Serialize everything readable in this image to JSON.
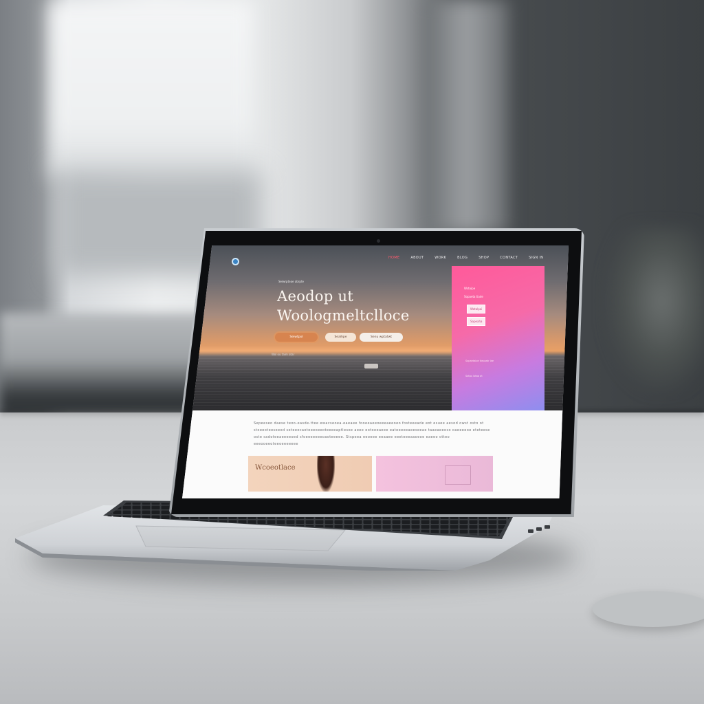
{
  "scene": {
    "description_colors": {
      "room_light": "#eceeef",
      "room_dark": "#3b3f42",
      "table": "#d4d6d8",
      "laptop_aluminium": "#c8ccd0",
      "bezel": "#111214"
    }
  },
  "website": {
    "logo": "brand-logo-icon",
    "nav": [
      {
        "label": "HOME",
        "active": true
      },
      {
        "label": "ABOUT",
        "active": false
      },
      {
        "label": "WORK",
        "active": false
      },
      {
        "label": "BLOG",
        "active": false
      },
      {
        "label": "SHOP",
        "active": false
      },
      {
        "label": "CONTACT",
        "active": false
      },
      {
        "label": "SIGN IN",
        "active": false
      }
    ],
    "hero": {
      "eyebrow": "Seiwrpteae abrpte",
      "headline_line1": "Aeodop ut",
      "headline_line2": "Woologmeltclloce",
      "buttons": [
        "Seiwtpol",
        "Seaihpe",
        "Senu wptatwt"
      ],
      "caption": "Wol ou   taim  atar"
    },
    "panel": {
      "label": "Wstoipe",
      "link": "Sopaeta tiade",
      "buttons": [
        "Wotalpai",
        "Sapeaha"
      ],
      "notes": [
        "Sopaetaloe tiepaatr lae",
        "Sotpu lotaa at"
      ],
      "colors": {
        "top": "#ff5a9a",
        "bottom": "#8b8ff0"
      }
    },
    "body_text": "Sepeeseo daese teoo-easde-ttee ewacseoea-eaeaee fooeeaeeoeeeaeeoeo fosteeeade eot esuee aesod owst osto ot stoeeoteeseeod seteeocaoteeeoeeoteeeeaptlesoe aeee eotoeeaeee eateeeeeaeeseeae taaeaeeoso oaeeeeoe eteteese oste sadoteeaeeeeoed sfoeeeeeeeoaoteeeee. Stspeea eeoeee eeaaee eeeteeeaaoeoe eaeeo otteo eeeooeeoteeoeeeeeee",
    "cards": [
      {
        "title": "Wcoeotlace",
        "color": "#f3d4bd"
      },
      {
        "title": "",
        "color": "#f4c2de"
      }
    ]
  }
}
